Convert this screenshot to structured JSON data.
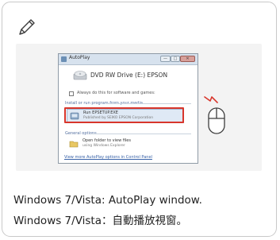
{
  "autoplay_window": {
    "title": "AutoPlay",
    "controls": {
      "minimize": "—",
      "maximize": "□",
      "close": "✕"
    },
    "drive_label": "DVD RW Drive (E:) EPSON",
    "always_checkbox_label": "Always do this for software and games:",
    "section_install": "Install or run program from your media",
    "option_run": {
      "title": "Run EPSETUP.EXE",
      "subtitle": "Published by SEIKO EPSON Corporation"
    },
    "section_general": "General options",
    "option_open": {
      "title": "Open folder to view files",
      "subtitle": "using Windows Explorer"
    },
    "control_panel_link": "View more AutoPlay options in Control Panel"
  },
  "caption": {
    "line_en": "Windows 7/Vista: AutoPlay window.",
    "line_zh": "Windows 7/Vista：自動播放視窗。"
  },
  "colors": {
    "highlight": "#d8362c",
    "card_border": "#c9c9c9",
    "panel_bg": "#f3f3f3"
  },
  "icons": {
    "note": "pencil-icon",
    "drive": "dvd-drive-icon",
    "run": "setup-program-icon",
    "folder": "folder-icon",
    "mouse": "mouse-click-icon"
  }
}
